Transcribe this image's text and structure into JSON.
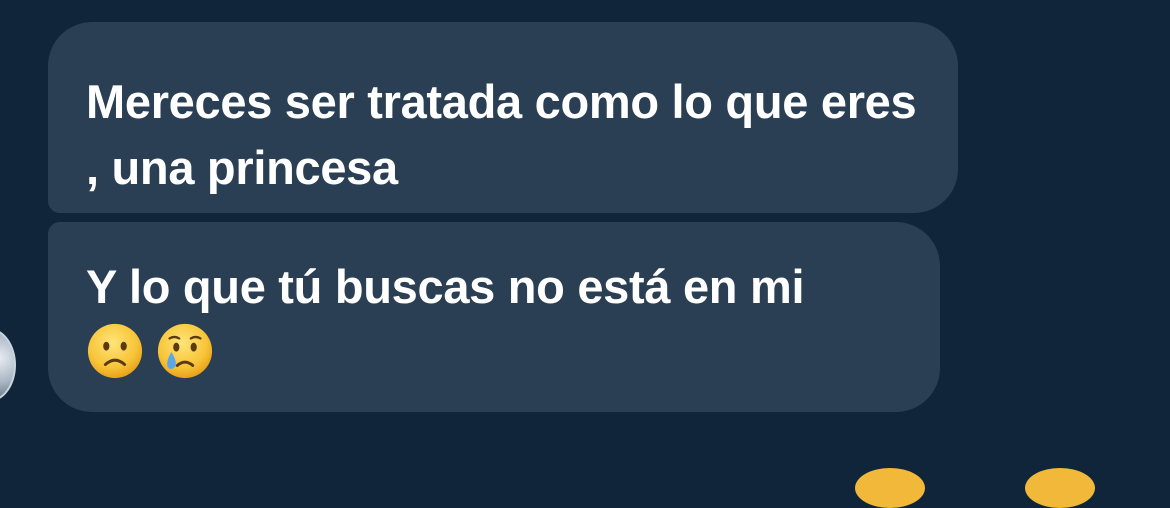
{
  "messages": [
    {
      "text": "Mereces ser tratada como lo que eres , una princesa"
    },
    {
      "text": "Y lo que tú buscas no está en mi",
      "emojis": [
        "slightly-frowning-face-emoji",
        "crying-face-emoji"
      ]
    }
  ],
  "colors": {
    "background": "#11253a",
    "bubble": "#2a3f53",
    "text": "#ffffff",
    "emoji_yellow": "#f2b83a",
    "tear_blue": "#5aa6e8"
  }
}
